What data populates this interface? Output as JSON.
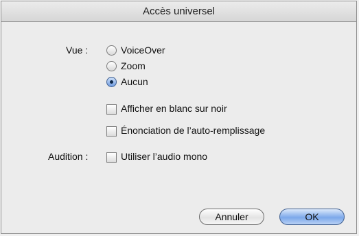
{
  "window": {
    "title": "Accès universel"
  },
  "vue": {
    "label": "Vue :",
    "options": [
      {
        "label": "VoiceOver",
        "selected": false
      },
      {
        "label": "Zoom",
        "selected": false
      },
      {
        "label": "Aucun",
        "selected": true
      }
    ],
    "checkboxes": [
      {
        "label": "Afficher en blanc sur noir",
        "checked": false
      },
      {
        "label": "Énonciation de l’auto-remplissage",
        "checked": false
      }
    ]
  },
  "audition": {
    "label": "Audition :",
    "checkbox_label": "Utiliser l’audio mono",
    "checked": false
  },
  "buttons": {
    "cancel": "Annuler",
    "ok": "OK"
  },
  "colors": {
    "default_button": "#7ca8ea",
    "selected_radio": "#6f9be0"
  }
}
